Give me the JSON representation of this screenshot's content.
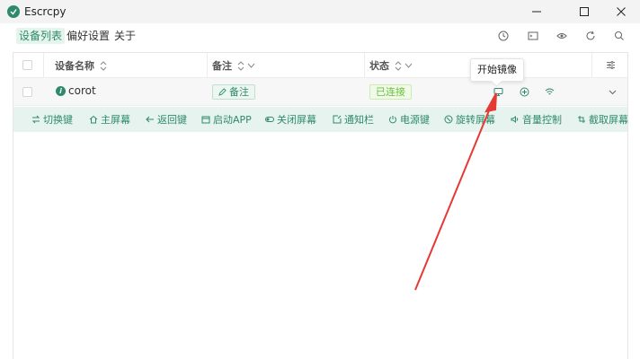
{
  "window": {
    "title": "Escrcpy"
  },
  "menu": {
    "tabs": [
      "设备列表",
      "偏好设置",
      "关于"
    ],
    "active_tab": "设备列表"
  },
  "toolbar_icons": [
    "clock-icon",
    "terminal-icon",
    "eye-icon",
    "refresh-icon",
    "search-icon"
  ],
  "table": {
    "columns": {
      "name": "设备名称",
      "remark": "备注",
      "status": "状态"
    },
    "rows": [
      {
        "name": "corot",
        "remark": "备注",
        "status": "已连接"
      }
    ]
  },
  "tooltip": {
    "text": "开始镜像"
  },
  "actions": [
    {
      "label": "切换键",
      "icon": "switch-icon"
    },
    {
      "label": "主屏幕",
      "icon": "home-icon"
    },
    {
      "label": "返回键",
      "icon": "back-icon"
    },
    {
      "label": "启动APP",
      "icon": "app-icon"
    },
    {
      "label": "关闭屏幕",
      "icon": "screen-off-icon"
    },
    {
      "label": "通知栏",
      "icon": "notification-icon"
    },
    {
      "label": "电源键",
      "icon": "power-icon"
    },
    {
      "label": "旋转屏幕",
      "icon": "rotate-icon"
    },
    {
      "label": "音量控制",
      "icon": "volume-icon"
    },
    {
      "label": "截取屏幕",
      "icon": "screenshot-icon"
    }
  ],
  "colors": {
    "accent": "#2f8a6b",
    "action_bar_bg": "#e7f3ee",
    "status_green": "#67c23a",
    "annotation_red": "#e53935"
  }
}
